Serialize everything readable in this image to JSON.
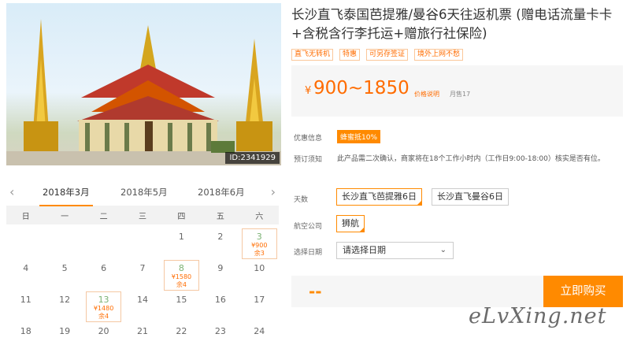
{
  "photo": {
    "id_label": "ID:2341929",
    "alt": "temple-photo"
  },
  "product": {
    "title": "长沙直飞泰国芭提雅/曼谷6天往返机票 (赠电话流量卡卡+含税含行李托运+赠旅行社保险)",
    "tags": [
      "直飞无转机",
      "特惠",
      "可另存签证",
      "境外上网不愁"
    ],
    "price_symbol": "¥",
    "price_range": "900~1850",
    "price_explain": "价格说明",
    "sold": "月售17"
  },
  "info": {
    "promo_label": "优惠信息",
    "promo_value": "蜂蜜抵10%",
    "notice_label": "预订须知",
    "notice_value": "此产品需二次确认，商家将在18个工作小时内（工作日9:00-18:00）核实是否有位。",
    "days_label": "天数",
    "days_options": [
      "长沙直飞芭提雅6日",
      "长沙直飞曼谷6日"
    ],
    "airline_label": "航空公司",
    "airline_options": [
      "狮航"
    ],
    "date_label": "选择日期",
    "date_placeholder": "请选择日期"
  },
  "buy": {
    "price_dash": "--",
    "button": "立即购买"
  },
  "calendar": {
    "months": [
      "2018年3月",
      "2018年5月",
      "2018年6月"
    ],
    "weekdays": [
      "日",
      "一",
      "二",
      "三",
      "四",
      "五",
      "六"
    ],
    "days": [
      {
        "d": ""
      },
      {
        "d": ""
      },
      {
        "d": ""
      },
      {
        "d": ""
      },
      {
        "d": "1"
      },
      {
        "d": "2"
      },
      {
        "d": "3",
        "price": "¥900",
        "left": "余3"
      },
      {
        "d": "4"
      },
      {
        "d": "5"
      },
      {
        "d": "6"
      },
      {
        "d": "7"
      },
      {
        "d": "8",
        "price": "¥1580",
        "left": "余4"
      },
      {
        "d": "9"
      },
      {
        "d": "10"
      },
      {
        "d": "11"
      },
      {
        "d": "12"
      },
      {
        "d": "13",
        "price": "¥1480",
        "left": "余4"
      },
      {
        "d": "14"
      },
      {
        "d": "15"
      },
      {
        "d": "16"
      },
      {
        "d": "17"
      },
      {
        "d": "18"
      },
      {
        "d": "19"
      },
      {
        "d": "20"
      },
      {
        "d": "21"
      },
      {
        "d": "22"
      },
      {
        "d": "23"
      },
      {
        "d": "24"
      }
    ]
  },
  "watermark": "eLvXing.net",
  "colors": {
    "accent": "#ff8a00",
    "price": "#ff6c00",
    "available_day": "#7bb274"
  }
}
